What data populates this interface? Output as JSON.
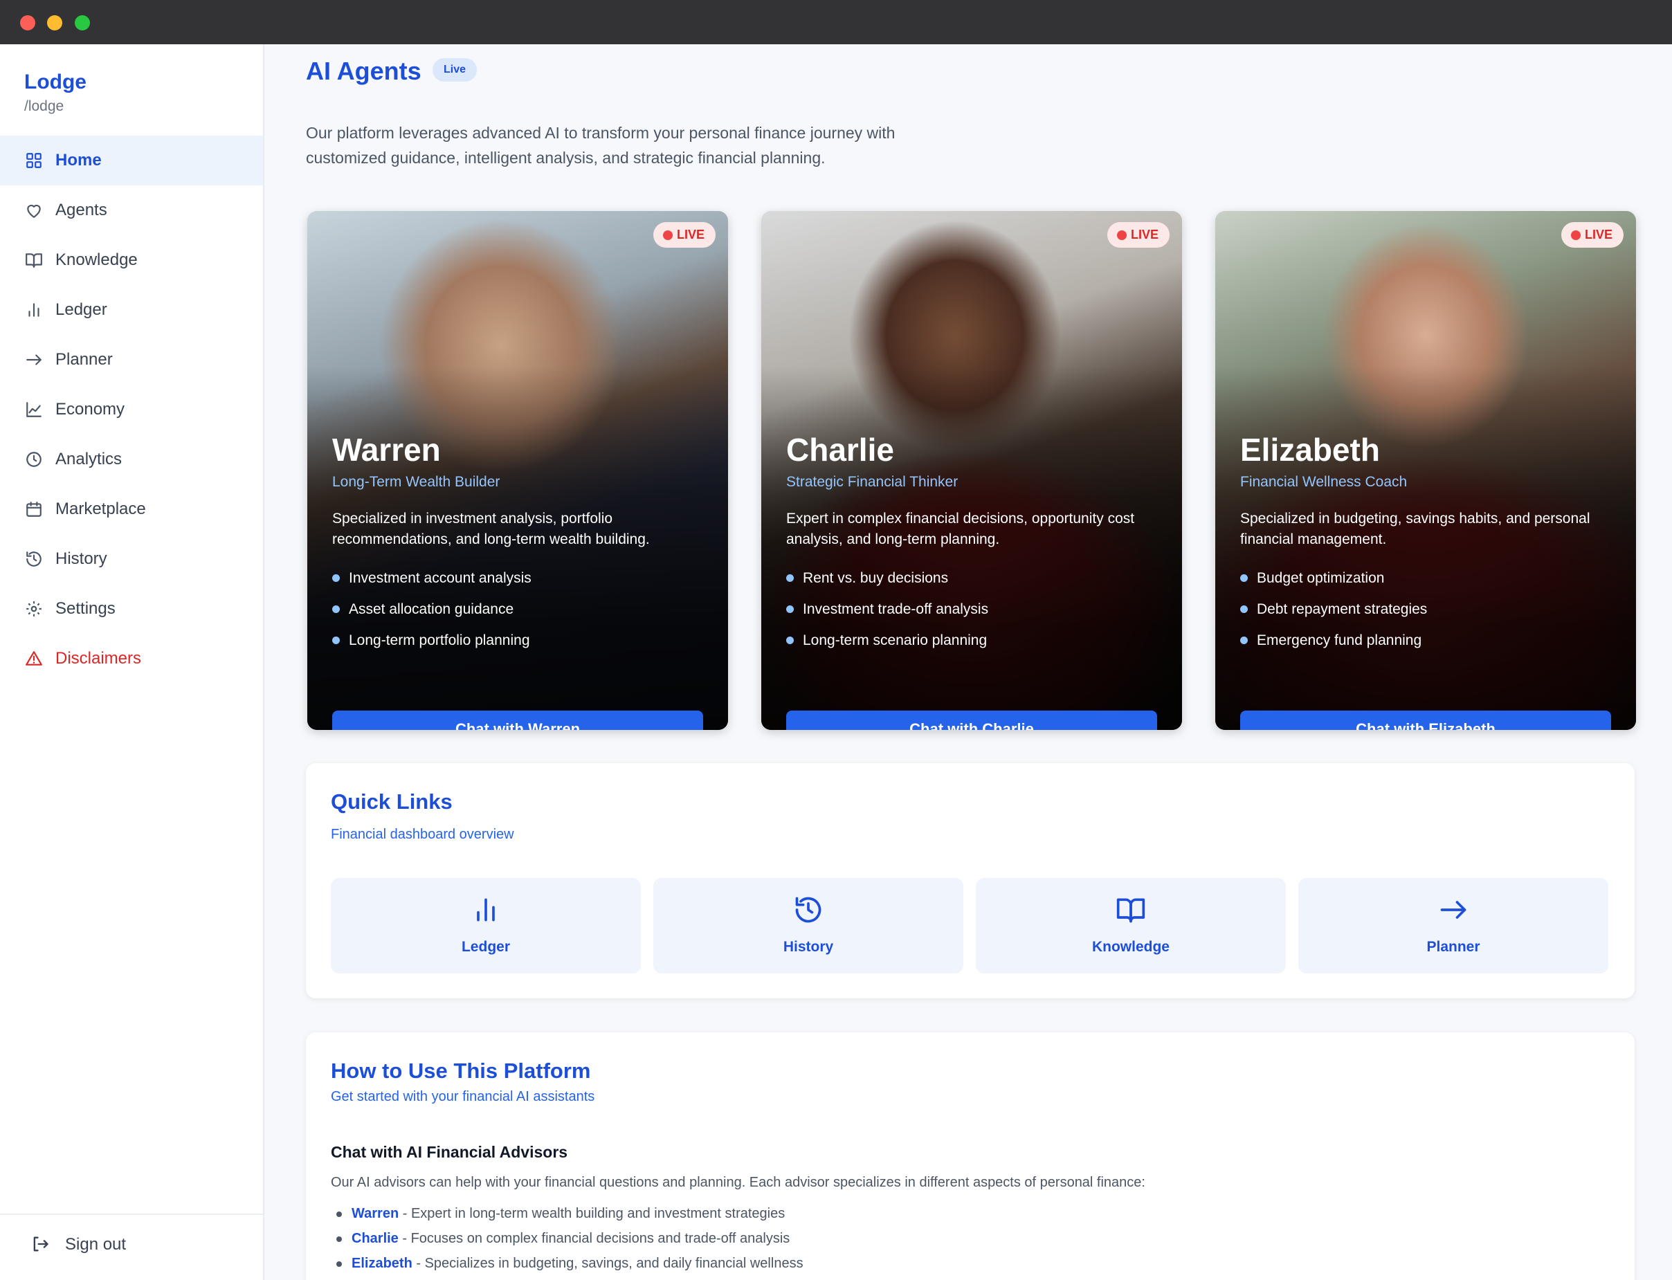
{
  "sidebar": {
    "brand": "Lodge",
    "brand_sub": "/lodge",
    "items": [
      {
        "label": "Home",
        "icon": "grid-icon"
      },
      {
        "label": "Agents",
        "icon": "heart-icon"
      },
      {
        "label": "Knowledge",
        "icon": "book-icon"
      },
      {
        "label": "Ledger",
        "icon": "bar-chart-icon"
      },
      {
        "label": "Planner",
        "icon": "arrow-right-icon"
      },
      {
        "label": "Economy",
        "icon": "line-chart-icon"
      },
      {
        "label": "Analytics",
        "icon": "clock-icon"
      },
      {
        "label": "Marketplace",
        "icon": "calendar-icon"
      },
      {
        "label": "History",
        "icon": "history-icon"
      },
      {
        "label": "Settings",
        "icon": "gear-icon"
      },
      {
        "label": "Disclaimers",
        "icon": "warning-icon"
      }
    ],
    "active": "Home",
    "signout": "Sign out"
  },
  "header": {
    "title": "AI Agents",
    "badge": "Live",
    "intro": "Our platform leverages advanced AI to transform your personal finance journey with customized guidance, intelligent analysis, and strategic financial planning."
  },
  "agents": [
    {
      "name": "Warren",
      "role": "Long-Term Wealth Builder",
      "status": "LIVE",
      "description": "Specialized in investment analysis, portfolio recommendations, and long-term wealth building.",
      "points": [
        "Investment account analysis",
        "Asset allocation guidance",
        "Long-term portfolio planning"
      ],
      "button": "Chat with Warren"
    },
    {
      "name": "Charlie",
      "role": "Strategic Financial Thinker",
      "status": "LIVE",
      "description": "Expert in complex financial decisions, opportunity cost analysis, and long-term planning.",
      "points": [
        "Rent vs. buy decisions",
        "Investment trade-off analysis",
        "Long-term scenario planning"
      ],
      "button": "Chat with Charlie"
    },
    {
      "name": "Elizabeth",
      "role": "Financial Wellness Coach",
      "status": "LIVE",
      "description": "Specialized in budgeting, savings habits, and personal financial management.",
      "points": [
        "Budget optimization",
        "Debt repayment strategies",
        "Emergency fund planning"
      ],
      "button": "Chat with Elizabeth"
    }
  ],
  "quick_links": {
    "title": "Quick Links",
    "subtitle": "Financial dashboard overview",
    "tiles": [
      {
        "label": "Ledger",
        "icon": "bar-chart-icon"
      },
      {
        "label": "History",
        "icon": "history-icon"
      },
      {
        "label": "Knowledge",
        "icon": "book-icon"
      },
      {
        "label": "Planner",
        "icon": "arrow-right-icon"
      }
    ]
  },
  "howto": {
    "title": "How to Use This Platform",
    "subtitle": "Get started with your financial AI assistants",
    "heading": "Chat with AI Financial Advisors",
    "paragraph": "Our AI advisors can help with your financial questions and planning. Each advisor specializes in different aspects of personal finance:",
    "items": [
      {
        "name": "Warren",
        "text": " - Expert in long-term wealth building and investment strategies"
      },
      {
        "name": "Charlie",
        "text": " - Focuses on complex financial decisions and trade-off analysis"
      },
      {
        "name": "Elizabeth",
        "text": " - Specializes in budgeting, savings, and daily financial wellness"
      }
    ]
  },
  "colors": {
    "accent": "#1d4ed8",
    "button": "#2563eb",
    "danger": "#dc2626",
    "live": "#ef4444"
  }
}
